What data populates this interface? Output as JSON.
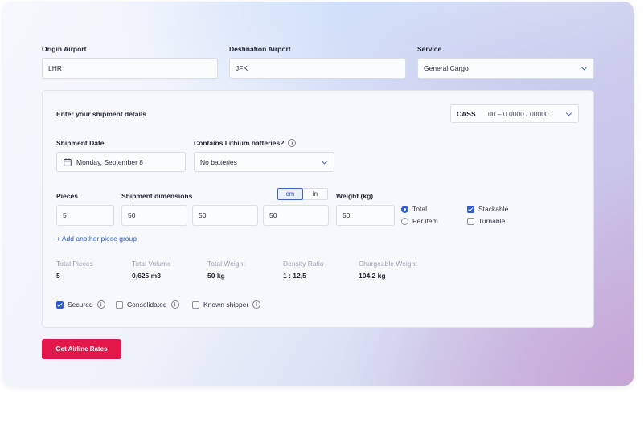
{
  "route": {
    "origin_label": "Origin Airport",
    "origin_value": "LHR",
    "destination_label": "Destination Airport",
    "destination_value": "JFK",
    "service_label": "Service",
    "service_value": "General Cargo"
  },
  "shipment": {
    "heading": "Enter your shipment details",
    "cass_label": "CASS",
    "cass_value": "00 – 0 0000 / 00000",
    "date_label": "Shipment Date",
    "date_value": "Monday, September 8",
    "lithium_label": "Contains Lithium batteries?",
    "lithium_value": "No batteries",
    "pieces_label": "Pieces",
    "pieces_value": "5",
    "dimensions_label": "Shipment dimensions",
    "unit_cm": "cm",
    "unit_in": "in",
    "dim_length": "50",
    "dim_width": "50",
    "dim_height": "50",
    "weight_label": "Weight (kg)",
    "weight_value": "50",
    "total_label": "Total",
    "per_item_label": "Per item",
    "stackable_label": "Stackable",
    "turnable_label": "Turnable",
    "add_group_label": "+ Add another piece group"
  },
  "summary": [
    {
      "label": "Total Pieces",
      "value": "5"
    },
    {
      "label": "Total Volume",
      "value": "0,625 m3"
    },
    {
      "label": "Total Weight",
      "value": "50 kg"
    },
    {
      "label": "Density Ratio",
      "value": "1 : 12,5"
    },
    {
      "label": "Chargeable Weight",
      "value": "104,2 kg"
    }
  ],
  "flags": {
    "secured_label": "Secured",
    "consolidated_label": "Consolidated",
    "known_shipper_label": "Known shipper"
  },
  "actions": {
    "get_rates_label": "Get Airline Rates"
  },
  "colors": {
    "accent": "#2e5bd6",
    "primary_button": "#e3174a"
  }
}
